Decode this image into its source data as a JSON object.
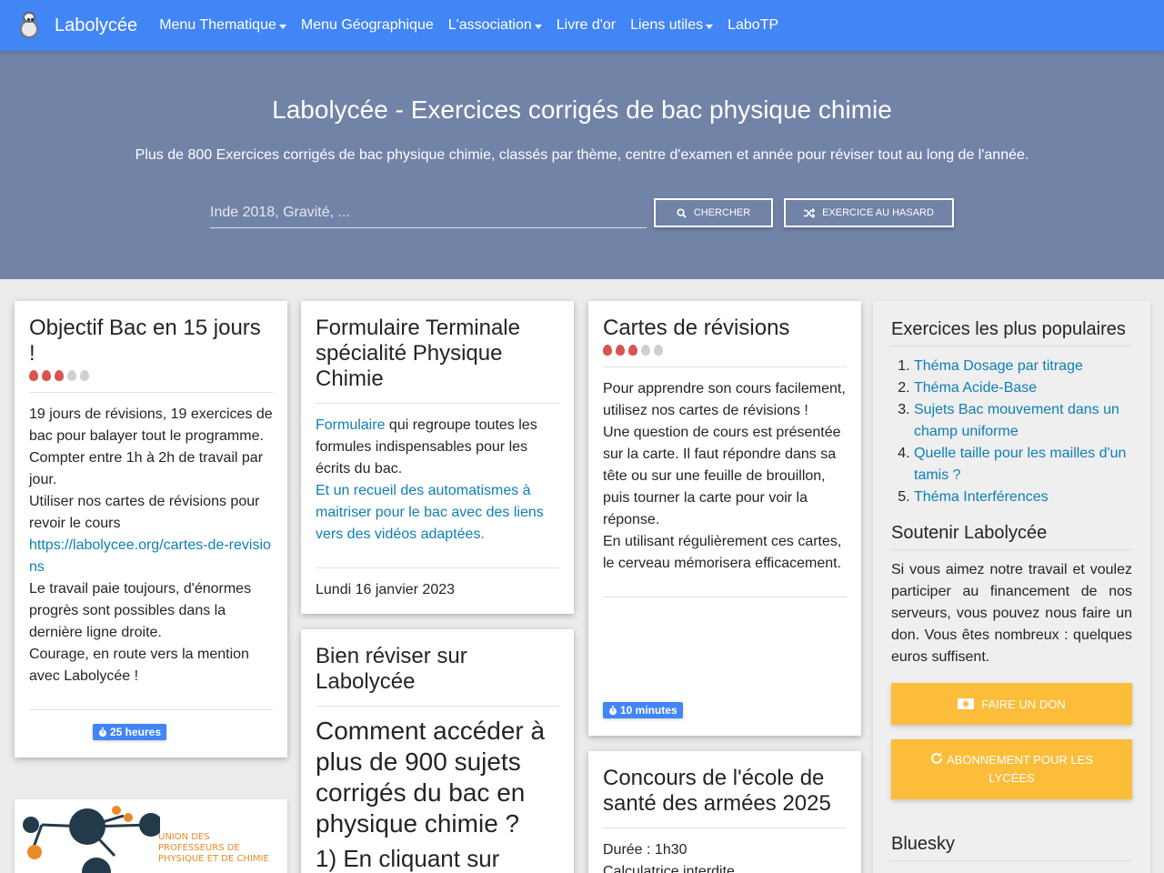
{
  "nav": {
    "brand": "Labolycée",
    "items": [
      {
        "label": "Menu Thematique",
        "dropdown": true
      },
      {
        "label": "Menu Géographique",
        "dropdown": false
      },
      {
        "label": "L'association",
        "dropdown": true
      },
      {
        "label": "Livre d'or",
        "dropdown": false
      },
      {
        "label": "Liens utiles",
        "dropdown": true
      },
      {
        "label": "LaboTP",
        "dropdown": false
      }
    ]
  },
  "hero": {
    "title": "Labolycée - Exercices corrigés de bac physique chimie",
    "subtitle": "Plus de 800 Exercices corrigés de bac physique chimie, classés par thème, centre d'examen et année pour réviser tout au long de l'année.",
    "search_placeholder": "Inde 2018, Gravité, ...",
    "search_label": "Chercher",
    "random_label": "Exercice au hasard"
  },
  "cards": {
    "bac15": {
      "title": "Objectif Bac en 15 jours !",
      "difficulty": 3,
      "lines": [
        "19 jours de révisions, 19 exercices de bac pour balayer tout le programme.",
        "Compter entre 1h à 2h de travail par jour.",
        "Utiliser nos cartes de révisions pour revoir le cours"
      ],
      "link": "https://labolycee.org/cartes-de-revisions",
      "lines2": [
        "Le travail paie toujours, d'énormes progrès sont possibles dans la dernière ligne droite.",
        "Courage, en route vers la mention avec Labolycée !"
      ],
      "badge": "25 heures"
    },
    "formulaire": {
      "title": "Formulaire Terminale spécialité Physique Chimie",
      "link1": "Formulaire",
      "text1": " qui regroupe toutes les formules indispensables pour les écrits du bac.",
      "link2": "Et un recueil des automatismes à maitriser pour le bac avec des liens vers des vidéos adaptées.",
      "date": "Lundi 16 janvier 2023"
    },
    "cartes": {
      "title": "Cartes de révisions",
      "difficulty": 3,
      "lines": [
        "Pour apprendre son cours facilement, utilisez nos cartes de révisions !",
        "Une question de cours est présentée sur la carte. Il faut répondre dans sa tête ou sur une feuille de brouillon, puis tourner la carte pour voir la réponse.",
        "En utilisant régulièrement ces cartes, le cerveau mémorisera efficacement."
      ],
      "badge": "10 minutes"
    },
    "reviser": {
      "title": "Bien réviser sur Labolycée",
      "question": "Comment accéder à plus de 900 sujets corrigés du bac en physique chimie ?",
      "step1": "1) En cliquant sur"
    },
    "concours": {
      "title": "Concours de l'école de santé des armées 2025",
      "duree": "Durée : 1h30",
      "calc": "Calculatrice interdite"
    }
  },
  "sidebar": {
    "popular_title": "Exercices les plus populaires",
    "popular": [
      "Théma Dosage par titrage",
      "Théma Acide-Base",
      "Sujets Bac mouvement dans un champ uniforme",
      "Quelle taille pour les mailles d'un tamis ?",
      "Théma Interférences"
    ],
    "support_title": "Soutenir Labolycée",
    "support_text": "Si vous aimez notre travail et voulez participer au financement de nos serveurs, vous pouvez nous faire un don. Vous êtes nombreux : quelques euros suffisent.",
    "donate_label": "Faire un don",
    "subscribe_label": "Abonnement pour les lycées",
    "bluesky_title": "Bluesky"
  },
  "udppc": {
    "line1": "UNION DES",
    "line2": "PROFESSEURS DE",
    "line3": "PHYSIQUE ET DE CHIMIE"
  },
  "colors": {
    "navbar": "#4285f4",
    "hero": "#7283a8",
    "link": "#0d7fb5",
    "badge": "#4285f4",
    "donate": "#fbbd3a",
    "flame": "#d9534f"
  }
}
